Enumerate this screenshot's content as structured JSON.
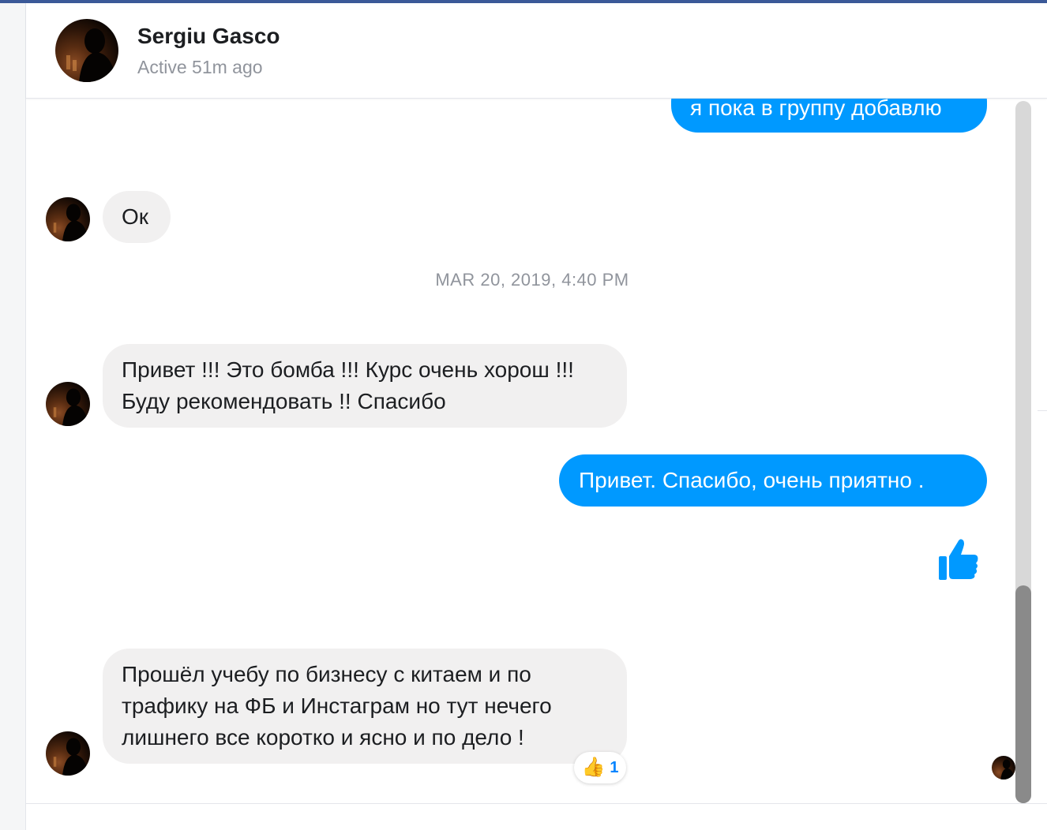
{
  "contact": {
    "name": "Sergiu Gasco",
    "status": "Active 51m ago"
  },
  "messages": [
    {
      "direction": "outgoing",
      "text": "я пока в группу добавлю"
    },
    {
      "direction": "incoming",
      "text": "Ок"
    },
    {
      "direction": "incoming",
      "text": "Привет !!! Это бомба !!! Курс очень хорош !!! Буду рекомендовать !!  Спасибо"
    },
    {
      "direction": "outgoing",
      "text": "Привет.  Спасибо, очень приятно ."
    },
    {
      "direction": "outgoing",
      "sticker": "thumbs-up-icon"
    },
    {
      "direction": "incoming",
      "text": "Прошёл учебу по бизнесу с китаем и по трафику на ФБ и Инстаграм но тут нечего лишнего все коротко и ясно и по дело !"
    }
  ],
  "timestamp": "MAR 20, 2019, 4:40 PM",
  "reaction": {
    "emoji": "👍",
    "count": "1"
  },
  "colors": {
    "accent": "#0099ff",
    "incoming_bubble": "#f1f0f0",
    "muted_text": "#90949c",
    "brand_bar": "#3b5998"
  }
}
